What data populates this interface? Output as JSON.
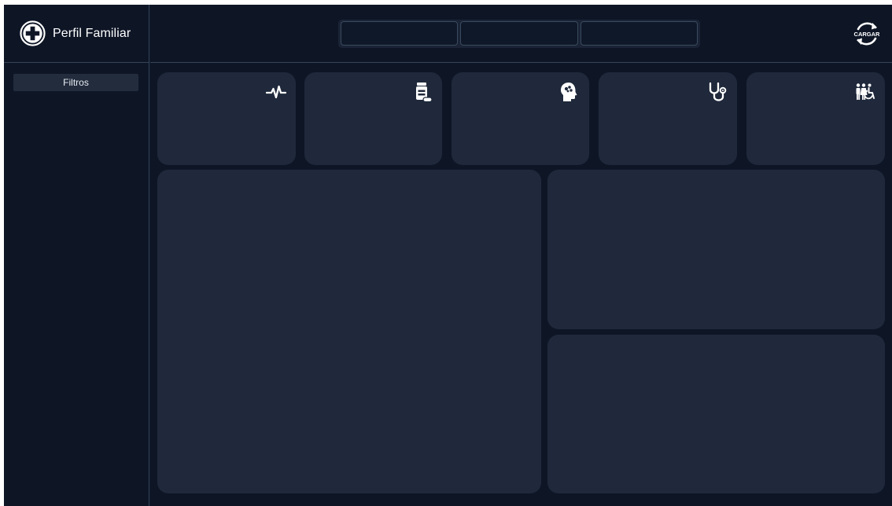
{
  "app": {
    "title": "Perfil Familiar",
    "logo_icon": "medical-plus-icon"
  },
  "sidebar": {
    "filter_label": "Filtros"
  },
  "header": {
    "slicers": [
      "",
      "",
      ""
    ],
    "reload_label": "CARGAR",
    "reload_icon": "refresh-icon"
  },
  "kpi_cards": [
    {
      "icon": "heartbeat-icon"
    },
    {
      "icon": "medicine-bottle-icon"
    },
    {
      "icon": "brain-head-icon"
    },
    {
      "icon": "stethoscope-icon"
    },
    {
      "icon": "family-accessibility-icon"
    }
  ],
  "colors": {
    "background": "#0e1626",
    "card": "#1f293b",
    "divider": "#34445a",
    "text": "#ffffff"
  }
}
